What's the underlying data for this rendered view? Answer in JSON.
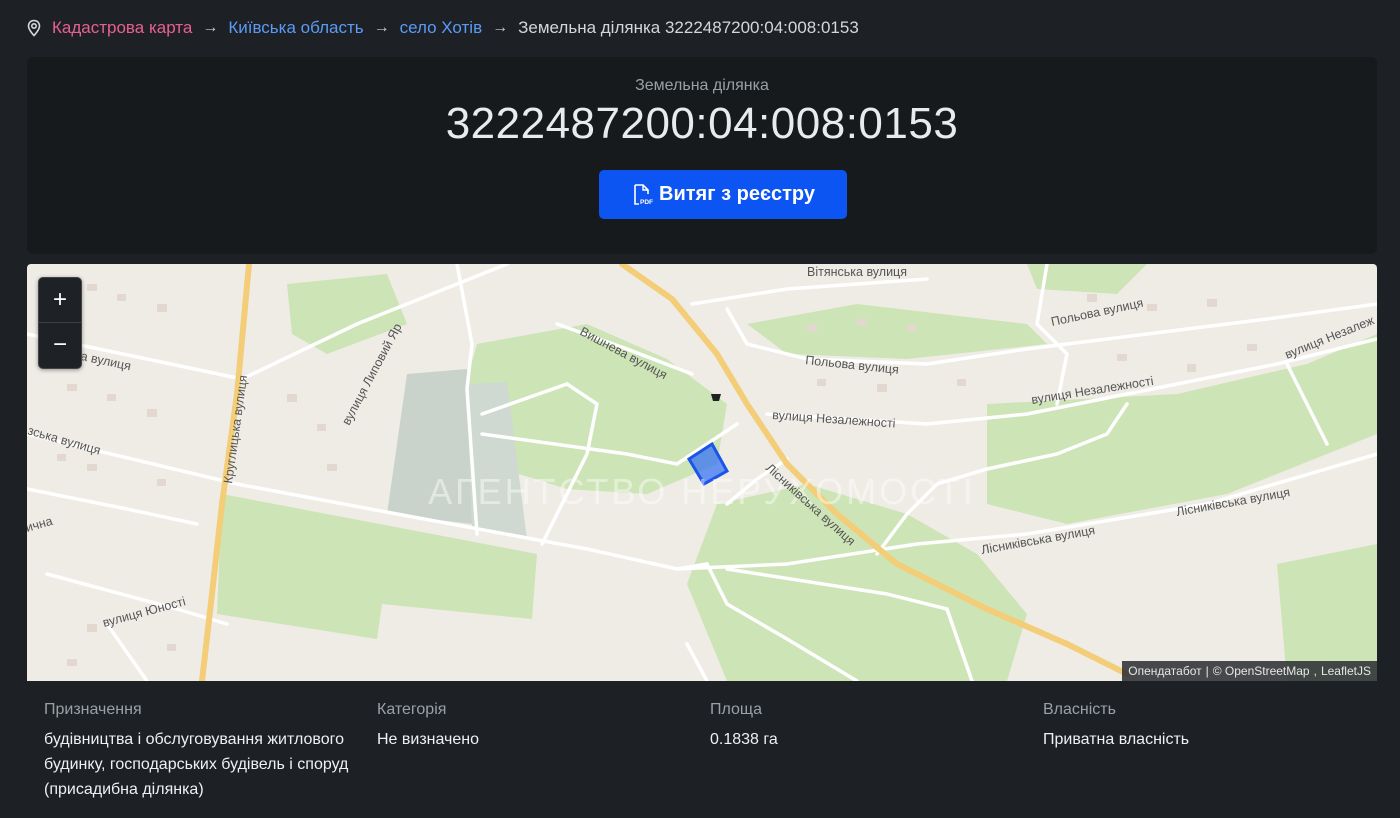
{
  "breadcrumb": {
    "items": [
      "Кадастрова карта",
      "Київська область",
      "село Хотів"
    ],
    "current": "Земельна ділянка 3222487200:04:008:0153"
  },
  "header": {
    "subtitle": "Земельна ділянка",
    "title": "3222487200:04:008:0153",
    "button_label": "Витяг з реєстру"
  },
  "map": {
    "zoom_in": "+",
    "zoom_out": "−",
    "attribution": {
      "source": "Опендатабот",
      "separator": "|",
      "osm": "© OpenStreetMap",
      "leaflet": "LeafletJS"
    },
    "streets": [
      "Вітянська вулиця",
      "Польова вулиця",
      "Польова вулиця",
      "вулиця Незалежності",
      "вулиця Незалежності",
      "вулиця Незалеж",
      "Вишнева вулиця",
      "вулиця Липовий Яр",
      "Круглицька вулиця",
      "ова вулиця",
      "зська вулиця",
      "Лісниківська вулиця",
      "Лісниківська вулиця",
      "Лісниківська вулиця",
      "вулиця Юності",
      "ична"
    ],
    "watermark": "АГЕНТСТВО НЕРУХОМОСТІ",
    "colors": {
      "parcel": "#2f6df5",
      "road": "#f3cd77",
      "green": "#cde4b7"
    }
  },
  "info": [
    {
      "label": "Призначення",
      "value": "будівництва і обслуговування житлового будинку, господарських будівель і споруд (присадибна ділянка)"
    },
    {
      "label": "Категорія",
      "value": "Не визначено"
    },
    {
      "label": "Площа",
      "value": "0.1838 га"
    },
    {
      "label": "Власність",
      "value": "Приватна власність"
    }
  ]
}
